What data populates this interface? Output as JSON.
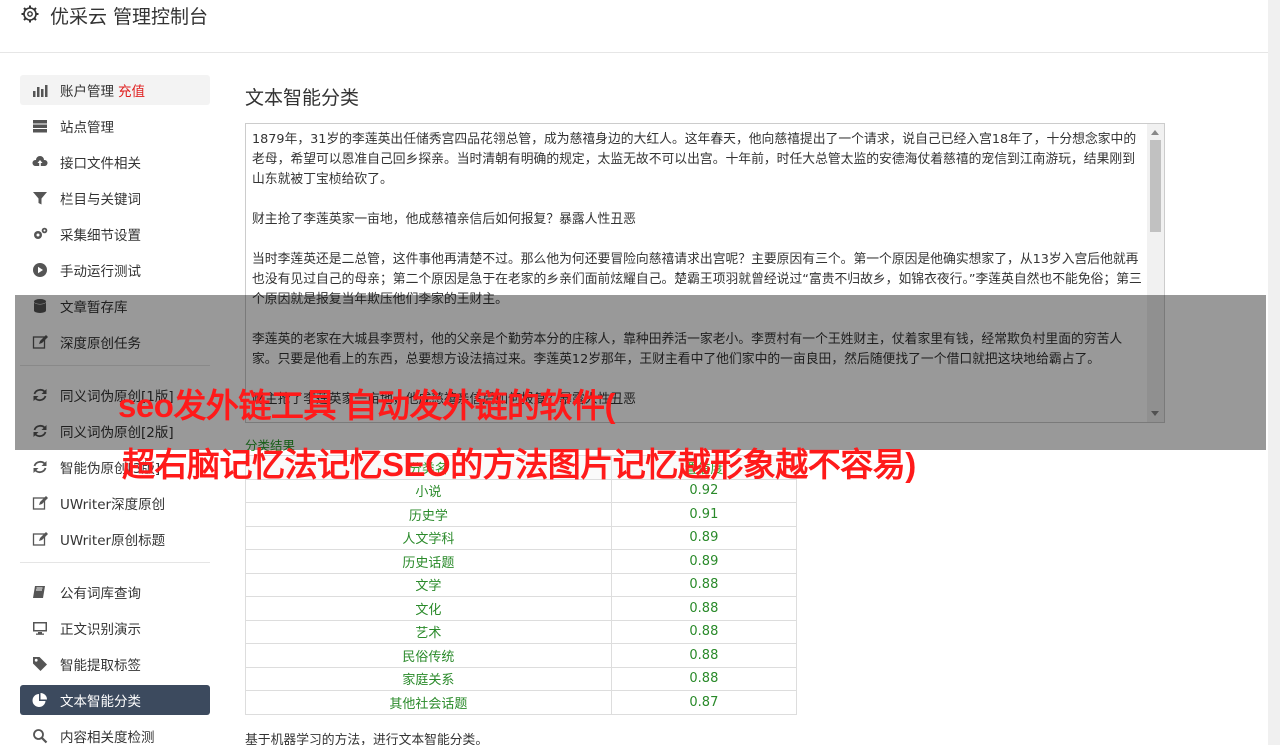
{
  "header": {
    "title": "优采云 管理控制台"
  },
  "sidebar": {
    "groups": [
      [
        {
          "label": "账户管理",
          "extra": "充值",
          "icon": "bar-chart-icon"
        },
        {
          "label": "站点管理",
          "icon": "server-icon"
        },
        {
          "label": "接口文件相关",
          "icon": "cloud-upload-icon"
        },
        {
          "label": "栏目与关键词",
          "icon": "filter-icon"
        },
        {
          "label": "采集细节设置",
          "icon": "gears-icon"
        },
        {
          "label": "手动运行测试",
          "icon": "play-circle-icon"
        },
        {
          "label": "文章暂存库",
          "icon": "database-icon"
        },
        {
          "label": "深度原创任务",
          "icon": "edit-icon"
        }
      ],
      [
        {
          "label": "同义词伪原创[1版]",
          "icon": "refresh-icon"
        },
        {
          "label": "同义词伪原创[2版]",
          "icon": "refresh-icon"
        },
        {
          "label": "智能伪原创[3版]",
          "icon": "refresh-icon"
        },
        {
          "label": "UWriter深度原创",
          "icon": "edit-icon"
        },
        {
          "label": "UWriter原创标题",
          "icon": "edit-icon"
        }
      ],
      [
        {
          "label": "公有词库查询",
          "icon": "book-icon"
        },
        {
          "label": "正文识别演示",
          "icon": "monitor-icon"
        },
        {
          "label": "智能提取标签",
          "icon": "tag-icon"
        },
        {
          "label": "文本智能分类",
          "icon": "pie-chart-icon",
          "active": true
        },
        {
          "label": "内容相关度检测",
          "icon": "search-icon"
        }
      ]
    ]
  },
  "main": {
    "title": "文本智能分类",
    "paragraphs": [
      "1879年，31岁的李莲英出任储秀宫四品花翎总管，成为慈禧身边的大红人。这年春天，他向慈禧提出了一个请求，说自己已经入宫18年了，十分想念家中的老母，希望可以恩准自己回乡探亲。当时清朝有明确的规定，太监无故不可以出宫。十年前，时任大总管太监的安德海仗着慈禧的宠信到江南游玩，结果刚到山东就被丁宝桢给砍了。",
      "财主抢了李莲英家一亩地，他成慈禧亲信后如何报复？暴露人性丑恶",
      "当时李莲英还是二总管，这件事他再清楚不过。那么他为何还要冒险向慈禧请求出宫呢？主要原因有三个。第一个原因是他确实想家了，从13岁入宫后他就再也没有见过自己的母亲；第二个原因是急于在老家的乡亲们面前炫耀自己。楚霸王项羽就曾经说过“富贵不归故乡，如锦衣夜行。”李莲英自然也不能免俗；第三个原因就是报复当年欺压他们李家的王财主。",
      "李莲英的老家在大城县李贾村，他的父亲是个勤劳本分的庄稼人，靠种田养活一家老小。李贾村有一个王姓财主，仗着家里有钱，经常欺负村里面的穷苦人家。只要是他看上的东西，总要想方设法搞过来。李莲英12岁那年，王财主看中了他们家中的一亩良田，然后随便找了一个借口就把这块地给霸占了。",
      "财主抢了李莲英家一亩地，他成慈禧亲信后如何报复？暴露人性丑恶"
    ],
    "result_label": "分类结果",
    "table": {
      "headers": [
        "分类名",
        "置信度"
      ],
      "rows": [
        [
          "小说",
          "0.92"
        ],
        [
          "历史学",
          "0.91"
        ],
        [
          "人文学科",
          "0.89"
        ],
        [
          "历史话题",
          "0.89"
        ],
        [
          "文学",
          "0.88"
        ],
        [
          "文化",
          "0.88"
        ],
        [
          "艺术",
          "0.88"
        ],
        [
          "民俗传统",
          "0.88"
        ],
        [
          "家庭关系",
          "0.88"
        ],
        [
          "其他社会话题",
          "0.87"
        ]
      ]
    },
    "note": "基于机器学习的方法，进行文本智能分类。"
  },
  "overlay": {
    "line1": "seo发外链工具 自动发外链的软件(",
    "line2": "超右脑记忆法记忆SEO的方法图片记忆越形象越不容易)"
  },
  "colors": {
    "active_bg": "#3c4a5e",
    "accent_red": "#e02020",
    "green": "#2a9d2a",
    "overlay_text": "#ff1a1a"
  }
}
